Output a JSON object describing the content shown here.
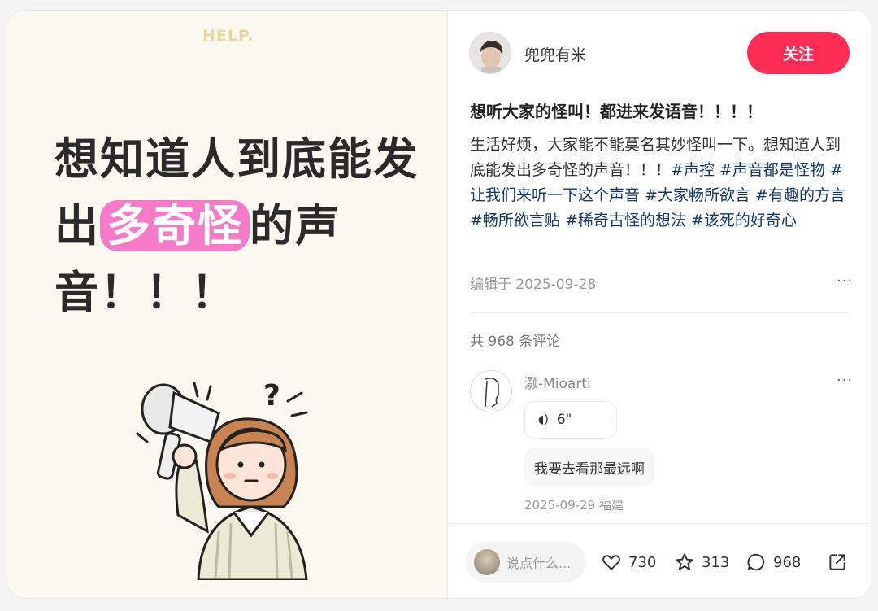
{
  "image": {
    "logo_text": "HELP.",
    "headline_part1": "想知道人到底能发出",
    "headline_highlight": "多奇怪",
    "headline_part2": "的声音！！！"
  },
  "author": {
    "name": "兜兜有米",
    "follow_label": "关注"
  },
  "post": {
    "title": "想听大家的怪叫！都进来发语音！！！！",
    "body_text": "生活好烦，大家能不能莫名其妙怪叫一下。想知道人到底能发出多奇怪的声音！！！",
    "tags": [
      "#声控",
      "#声音都是怪物",
      "#让我们来听一下这个声音",
      "#大家畅所欲言",
      "#有趣的方言",
      "#畅所欲言贴",
      "#稀奇古怪的想法",
      "#该死的好奇心"
    ],
    "edit_date": "编辑于 2025-09-28",
    "more": "···"
  },
  "comments": {
    "count_label": "共 968 条评论",
    "items": [
      {
        "author": "灏-Mioarti",
        "voice_duration": "6\"",
        "text": "我要去看那最远啊",
        "meta": "2025-09-29 福建",
        "more": "···"
      }
    ]
  },
  "bottom_bar": {
    "input_placeholder": "说点什么...",
    "likes": "730",
    "favorites": "313",
    "comments": "968"
  },
  "colors": {
    "accent": "#ff2d55",
    "tag": "#13386c",
    "highlight": "#f77ac9",
    "image_bg": "#fbf8ef"
  }
}
